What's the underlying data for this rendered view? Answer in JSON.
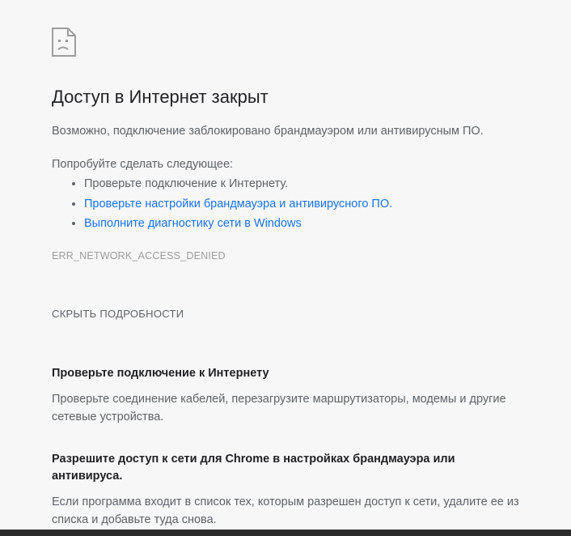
{
  "title": "Доступ в Интернет закрыт",
  "subtitle": "Возможно, подключение заблокировано брандмауэром или антивирусным ПО.",
  "tryLabel": "Попробуйте сделать следующее:",
  "suggestions": [
    {
      "text": "Проверьте подключение к Интернету.",
      "link": false
    },
    {
      "text": "Проверьте настройки брандмауэра и антивирусного ПО.",
      "link": true
    },
    {
      "text": "Выполните диагностику сети в Windows",
      "link": true
    }
  ],
  "errorCode": "ERR_NETWORK_ACCESS_DENIED",
  "detailsToggle": "СКРЫТЬ ПОДРОБНОСТИ",
  "details": [
    {
      "heading": "Проверьте подключение к Интернету",
      "body": "Проверьте соединение кабелей, перезагрузите маршрутизаторы, модемы и другие сетевые устройства."
    },
    {
      "heading": "Разрешите доступ к сети для Chrome в настройках брандмауэра или антивируса.",
      "body": "Если программа входит в список тех, которым разрешен доступ к сети, удалите ее из списка и добавьте туда снова."
    }
  ]
}
